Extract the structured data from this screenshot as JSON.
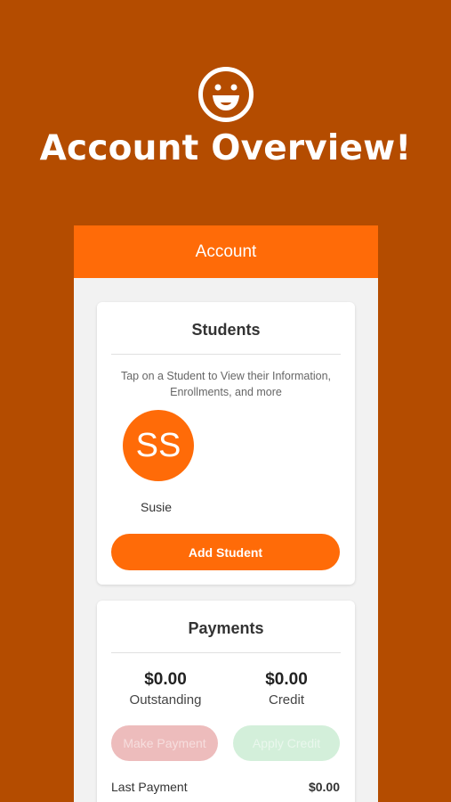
{
  "hero": {
    "title": "Account Overview!"
  },
  "app_bar": {
    "title": "Account"
  },
  "students": {
    "title": "Students",
    "hint": "Tap on a Student to View their Information, Enrollments, and more",
    "items": [
      {
        "initials": "SS",
        "name": "Susie"
      }
    ],
    "add_label": "Add Student"
  },
  "payments": {
    "title": "Payments",
    "outstanding_value": "$0.00",
    "outstanding_label": "Outstanding",
    "credit_value": "$0.00",
    "credit_label": "Credit",
    "make_payment_label": "Make Payment",
    "apply_credit_label": "Apply Credit",
    "last_payment_label": "Last Payment",
    "last_payment_value": "$0.00"
  },
  "colors": {
    "background": "#b44c00",
    "accent": "#ff6b08",
    "disabled_red": "#edbcbc",
    "disabled_green": "#d3efda"
  }
}
